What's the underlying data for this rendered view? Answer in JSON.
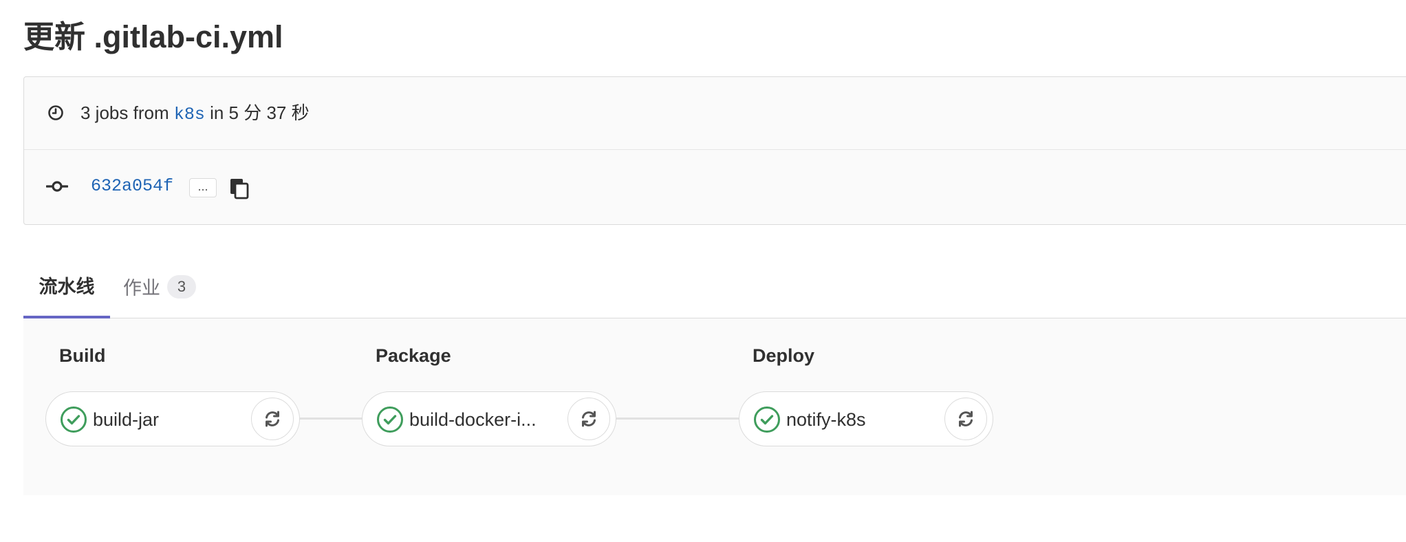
{
  "page": {
    "title": "更新 .gitlab-ci.yml"
  },
  "summary": {
    "prefix": "3 jobs from",
    "ref": "k8s",
    "suffix": "in 5 分 37 秒",
    "icon": "clock-icon"
  },
  "commit": {
    "sha": "632a054f",
    "expand_label": "...",
    "icon": "commit-icon",
    "copy_icon": "copy-icon"
  },
  "tabs": [
    {
      "label": "流水线",
      "active": true
    },
    {
      "label": "作业",
      "count": "3",
      "active": false
    }
  ],
  "stages": [
    {
      "name": "Build",
      "jobs": [
        {
          "name": "build-jar",
          "status": "success"
        }
      ]
    },
    {
      "name": "Package",
      "jobs": [
        {
          "name": "build-docker-i...",
          "status": "success"
        }
      ]
    },
    {
      "name": "Deploy",
      "jobs": [
        {
          "name": "notify-k8s",
          "status": "success"
        }
      ]
    }
  ],
  "colors": {
    "link": "#1f64b4",
    "success": "#3f9d5c",
    "active_tab": "#6666c4"
  }
}
